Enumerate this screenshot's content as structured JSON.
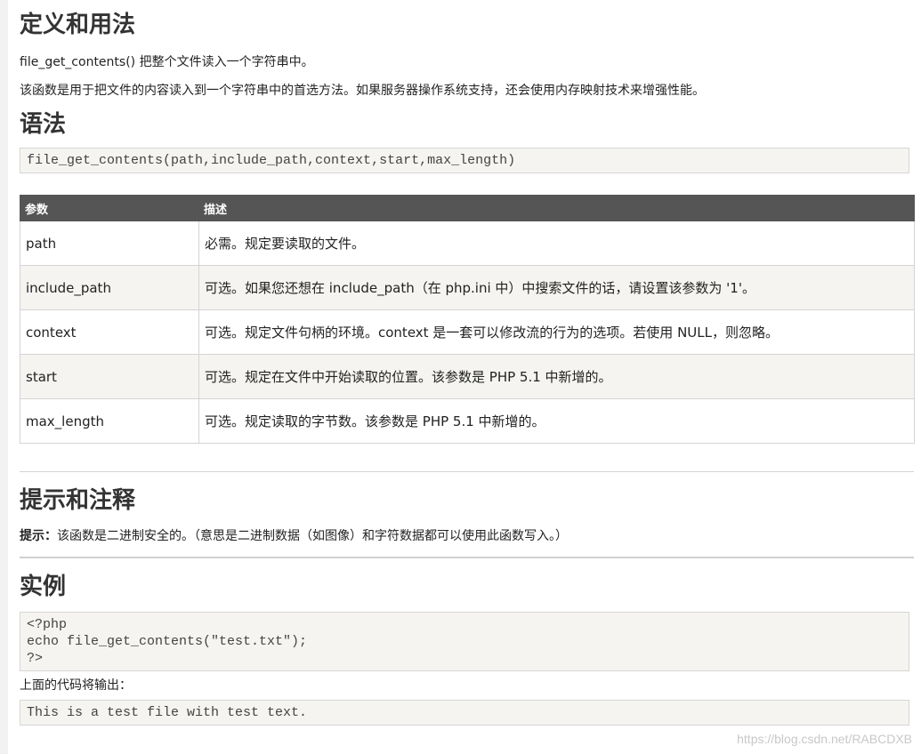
{
  "definition": {
    "heading": "定义和用法",
    "line1": "file_get_contents() 把整个文件读入一个字符串中。",
    "line2": "该函数是用于把文件的内容读入到一个字符串中的首选方法。如果服务器操作系统支持，还会使用内存映射技术来增强性能。"
  },
  "syntax": {
    "heading": "语法",
    "code": "file_get_contents(path,include_path,context,start,max_length)"
  },
  "params": {
    "headers": [
      "参数",
      "描述"
    ],
    "rows": [
      {
        "name": "path",
        "desc": "必需。规定要读取的文件。"
      },
      {
        "name": "include_path",
        "desc": "可选。如果您还想在 include_path（在 php.ini 中）中搜索文件的话，请设置该参数为 '1'。"
      },
      {
        "name": "context",
        "desc": "可选。规定文件句柄的环境。context 是一套可以修改流的行为的选项。若使用 NULL，则忽略。"
      },
      {
        "name": "start",
        "desc": "可选。规定在文件中开始读取的位置。该参数是 PHP 5.1 中新增的。"
      },
      {
        "name": "max_length",
        "desc": "可选。规定读取的字节数。该参数是 PHP 5.1 中新增的。"
      }
    ]
  },
  "tips": {
    "heading": "提示和注释",
    "label": "提示：",
    "text": "该函数是二进制安全的。（意思是二进制数据（如图像）和字符数据都可以使用此函数写入。）"
  },
  "example": {
    "heading": "实例",
    "code": "<?php\necho file_get_contents(\"test.txt\");\n?>",
    "output_label": "上面的代码将输出：",
    "output": "This is a test file with test text."
  },
  "watermark": "https://blog.csdn.net/RABCDXB",
  "colors": {
    "table_header_bg": "#555555",
    "code_bg": "#f5f4f0",
    "row_alt_bg": "#f5f4f0",
    "text": "#222222"
  }
}
